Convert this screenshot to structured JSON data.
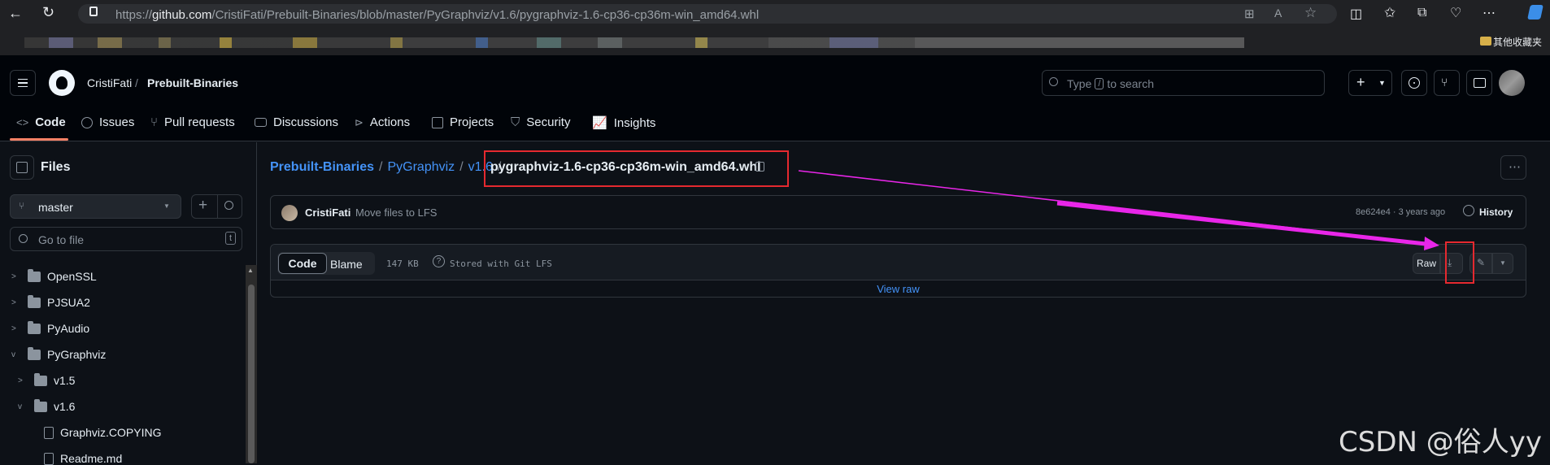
{
  "browser": {
    "url_prefix": "https://",
    "url_domain": "github.com",
    "url_path": "/CristiFati/Prebuilt-Binaries/blob/master/PyGraphviz/v1.6/pygraphviz-1.6-cp36-cp36m-win_amd64.whl",
    "bookmark_folder": "其他收藏夹"
  },
  "header": {
    "owner": "CristiFati",
    "separator": "/",
    "repo": "Prebuilt-Binaries",
    "search_prefix": "Type",
    "search_key": "/",
    "search_suffix": "to search",
    "plus": "+"
  },
  "nav": {
    "tabs": [
      "Code",
      "Issues",
      "Pull requests",
      "Discussions",
      "Actions",
      "Projects",
      "Security",
      "Insights"
    ]
  },
  "sidebar": {
    "title": "Files",
    "branch": "master",
    "search_placeholder": "Go to file",
    "search_shortcut": "t",
    "items": [
      {
        "label": "OpenSSL"
      },
      {
        "label": "PJSUA2"
      },
      {
        "label": "PyAudio"
      },
      {
        "label": "PyGraphviz"
      },
      {
        "label": "v1.5"
      },
      {
        "label": "v1.6"
      },
      {
        "label": "Graphviz.COPYING"
      },
      {
        "label": "Readme.md"
      }
    ]
  },
  "breadcrumb": {
    "repo": "Prebuilt-Binaries",
    "dir1": "PyGraphviz",
    "dir2": "v1.6",
    "sep": "/",
    "file": "pygraphviz-1.6-cp36-cp36m-win_amd64.whl"
  },
  "commit": {
    "author": "CristiFati",
    "message": "Move files to LFS",
    "hash_age": "8e624e4 · 3 years ago",
    "history": "History"
  },
  "file_toolbar": {
    "code": "Code",
    "blame": "Blame",
    "size": "147 KB",
    "lfs": "Stored with Git LFS",
    "raw": "Raw",
    "view_raw": "View raw"
  },
  "watermark": "CSDN @俗人yy",
  "colors": {
    "accent_link": "#4493f8",
    "annotation_red": "#e5292f",
    "annotation_arrow": "#e926e9"
  }
}
